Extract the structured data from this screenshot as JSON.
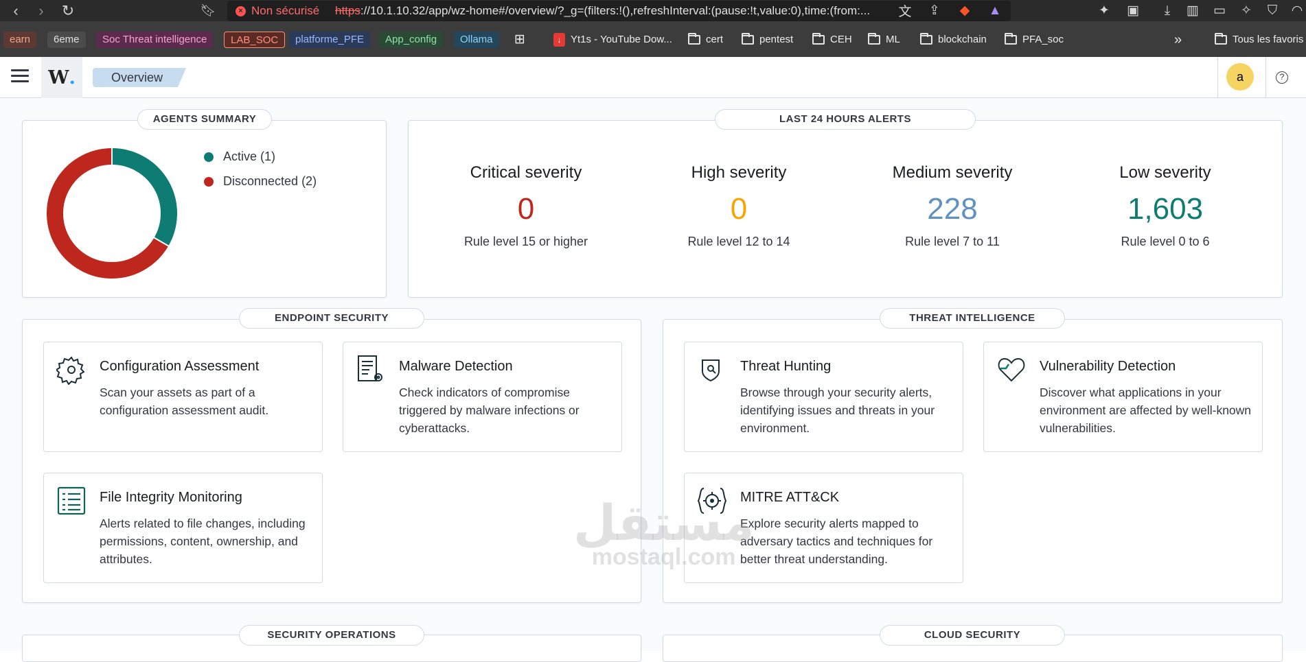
{
  "browser": {
    "not_secure": "Non sécurisé",
    "url_scheme": "https",
    "url_rest": "://10.1.10.32/app/wz-home#/overview/?_g=(filters:!(),refreshInterval:(pause:!t,value:0),time:(from:...",
    "bookmarks_tags": [
      {
        "label": "earn",
        "bg": "#5c3a33",
        "fg": "#f0a48f"
      },
      {
        "label": "6eme",
        "bg": "#4b4b4b",
        "fg": "#e0e0e0"
      },
      {
        "label": "Soc Threat intelligence",
        "bg": "#5b2a4d",
        "fg": "#f6a3d6"
      },
      {
        "label": "LAB_SOC",
        "bg": "#5a2b24",
        "fg": "#ff8f7a"
      },
      {
        "label": "platforme_PFE",
        "bg": "#2b3a58",
        "fg": "#9ab8ff"
      },
      {
        "label": "App_config",
        "bg": "#2b4a36",
        "fg": "#8fe0a8"
      },
      {
        "label": "Ollama",
        "bg": "#23465a",
        "fg": "#8fd1f5"
      }
    ],
    "bookmarks": [
      "Yt1s - YouTube Dow...",
      "cert",
      "pentest",
      "CEH",
      "ML",
      "blockchain",
      "PFA_soc"
    ],
    "more": "»",
    "all_bookmarks": "Tous les favoris"
  },
  "app": {
    "logo": "W",
    "breadcrumb": "Overview",
    "avatar": "a",
    "help": "?"
  },
  "agents": {
    "title": "AGENTS SUMMARY",
    "legend": [
      {
        "label": "Active (1)",
        "color": "#0f7c73"
      },
      {
        "label": "Disconnected (2)",
        "color": "#bd271e"
      }
    ],
    "chart_data": {
      "type": "pie",
      "categories": [
        "Active",
        "Disconnected"
      ],
      "values": [
        1,
        2
      ],
      "colors": [
        "#0f7c73",
        "#bd271e"
      ]
    }
  },
  "alerts": {
    "title": "LAST 24 HOURS ALERTS",
    "items": [
      {
        "heading": "Critical severity",
        "value": "0",
        "sub": "Rule level 15 or higher",
        "color": "#bd271e"
      },
      {
        "heading": "High severity",
        "value": "0",
        "sub": "Rule level 12 to 14",
        "color": "#f5a700"
      },
      {
        "heading": "Medium severity",
        "value": "228",
        "sub": "Rule level 7 to 11",
        "color": "#6092c0"
      },
      {
        "heading": "Low severity",
        "value": "1,603",
        "sub": "Rule level 0 to 6",
        "color": "#0f7c73"
      }
    ]
  },
  "endpoint": {
    "title": "ENDPOINT SECURITY",
    "cards": [
      {
        "title": "Configuration Assessment",
        "desc": "Scan your assets as part of a configuration assessment audit."
      },
      {
        "title": "Malware Detection",
        "desc": "Check indicators of compromise triggered by malware infections or cyberattacks."
      },
      {
        "title": "File Integrity Monitoring",
        "desc": "Alerts related to file changes, including permissions, content, ownership, and attributes."
      }
    ]
  },
  "threat": {
    "title": "THREAT INTELLIGENCE",
    "cards": [
      {
        "title": "Threat Hunting",
        "desc": "Browse through your security alerts, identifying issues and threats in your environment."
      },
      {
        "title": "Vulnerability Detection",
        "desc": "Discover what applications in your environment are affected by well-known vulnerabilities."
      },
      {
        "title": "MITRE ATT&CK",
        "desc": "Explore security alerts mapped to adversary tactics and techniques for better threat understanding."
      }
    ]
  },
  "security_operations": {
    "title": "SECURITY OPERATIONS"
  },
  "cloud_security": {
    "title": "CLOUD SECURITY"
  },
  "watermark": {
    "arabic": "مستقل",
    "latin": "mostaql.com"
  }
}
